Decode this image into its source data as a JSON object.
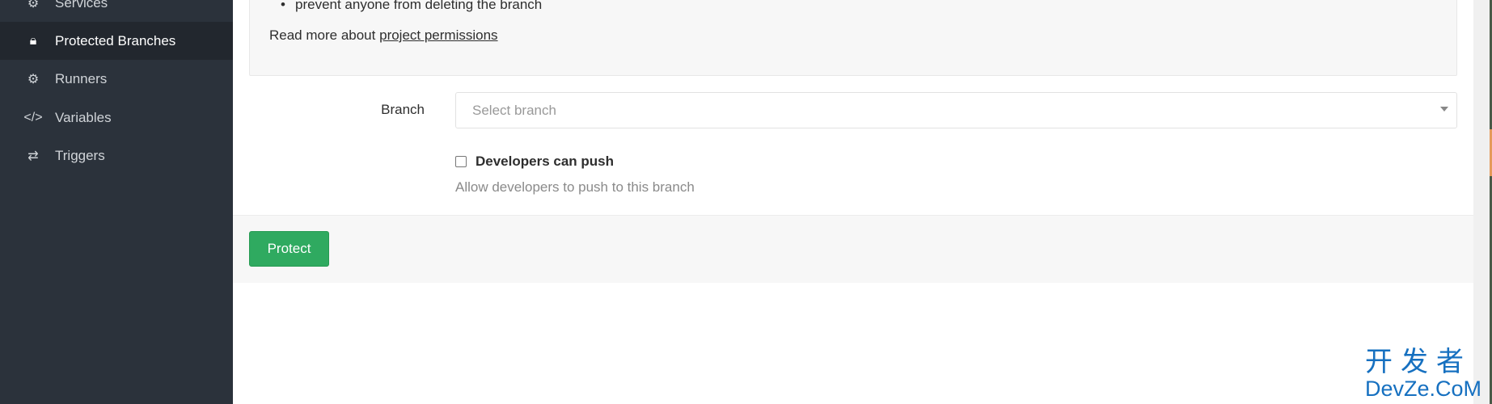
{
  "sidebar": {
    "items": [
      {
        "label": "Services",
        "icon": "gears-icon"
      },
      {
        "label": "Protected Branches",
        "icon": "lock-icon",
        "active": true
      },
      {
        "label": "Runners",
        "icon": "gear-icon"
      },
      {
        "label": "Variables",
        "icon": "code-icon"
      },
      {
        "label": "Triggers",
        "icon": "retweet-icon"
      }
    ]
  },
  "info": {
    "bullet": "prevent anyone from deleting the branch",
    "read_more": "Read more about",
    "link": "project permissions"
  },
  "form": {
    "branch_label": "Branch",
    "branch_placeholder": "Select branch",
    "checkbox_label": "Developers can push",
    "checkbox_checked": false,
    "help": "Allow developers to push to this branch"
  },
  "actions": {
    "protect": "Protect"
  },
  "watermark": {
    "line1": "开发者",
    "line2": "DevZe.CoM"
  },
  "colors": {
    "primary": "#2faa60",
    "sidebar": "#2b323b"
  }
}
